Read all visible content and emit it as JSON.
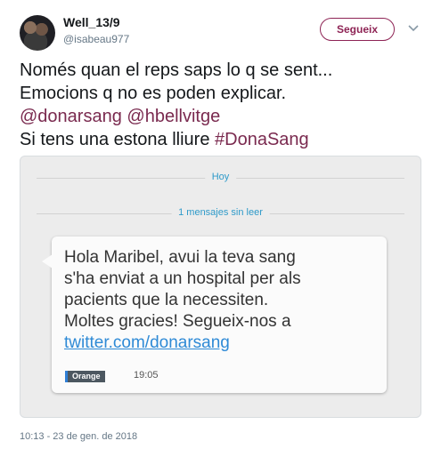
{
  "header": {
    "display_name": "Well_13/9",
    "handle": "@isabeau977",
    "follow_label": "Segueix",
    "menu_icon": "chevron-down-icon",
    "avatar_icon": "avatar"
  },
  "tweet": {
    "lines": [
      "Només quan el reps saps lo q se sent...",
      "Emocions q no es poden explicar."
    ],
    "mention_1": "@donarsang",
    "mention_2": "@hbellvitge",
    "line4_prefix": "Si tens una estona lliure",
    "hashtag": "#DonaSang"
  },
  "photo": {
    "date_separator": "Hoy",
    "unread_separator": "1 mensajes sin leer",
    "sms_lines": [
      "Hola Maribel, avui la teva sang",
      "s'ha enviat a un hospital per als",
      "pacients que la necessiten.",
      "Moltes gracies! Segueix-nos a"
    ],
    "sms_link": "twitter.com/donarsang",
    "carrier": "Orange",
    "sms_time": "19:05"
  },
  "footer": {
    "timestamp": "10:13 - 23 de gen. de 2018"
  },
  "colors": {
    "accent": "#8e2455",
    "link": "#7a2a4f",
    "sms_link": "#2e8ad6",
    "separator_text": "#2e9ac9"
  }
}
